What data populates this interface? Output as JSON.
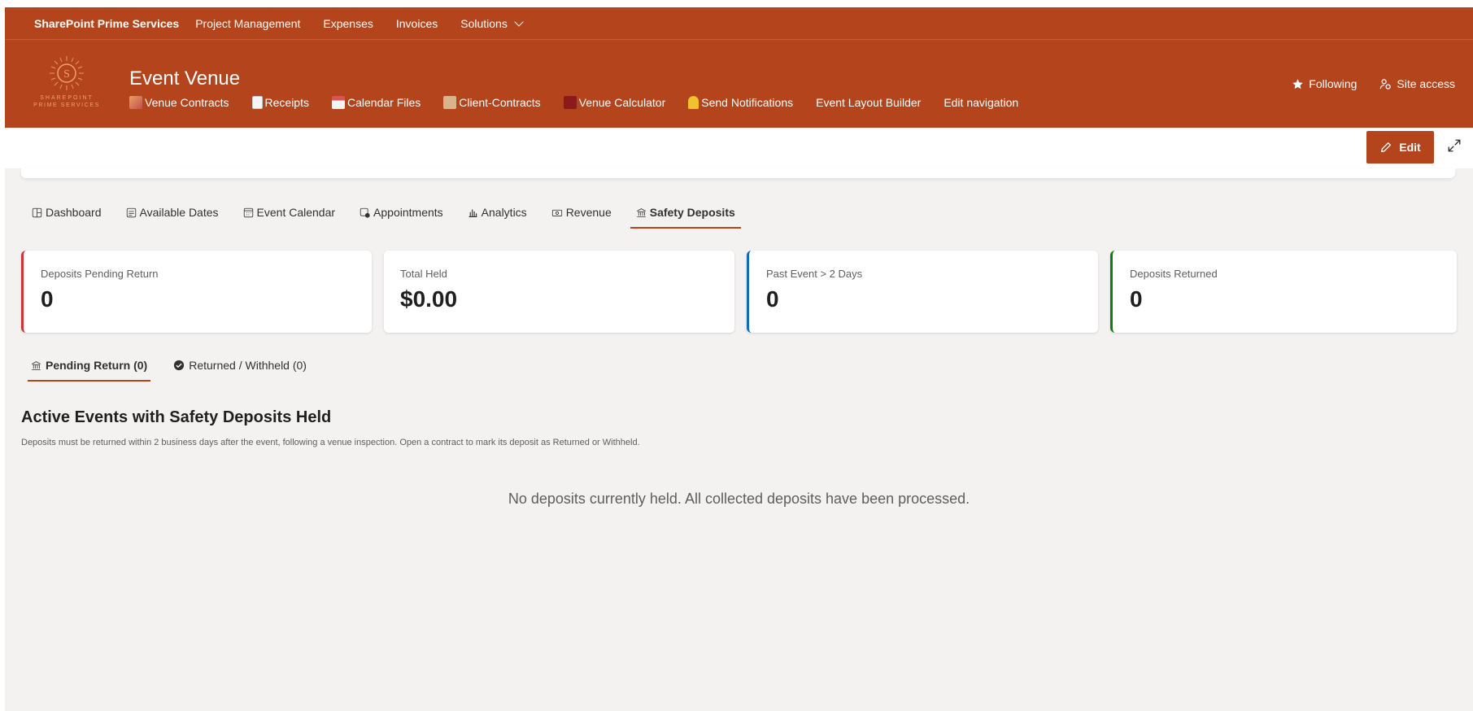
{
  "suite_bar": {
    "brand": "SharePoint Prime Services",
    "nav": [
      "Project Management",
      "Expenses",
      "Invoices",
      "Solutions"
    ]
  },
  "header": {
    "logo_text_line1": "SHAREPOINT",
    "logo_text_line2": "PRIME SERVICES",
    "logo_letter": "S",
    "site_title": "Event Venue",
    "nav": [
      {
        "label": "Venue Contracts",
        "icon": "people-emoji-icon"
      },
      {
        "label": "Receipts",
        "icon": "receipt-emoji-icon"
      },
      {
        "label": "Calendar Files",
        "icon": "calendar-emoji-icon"
      },
      {
        "label": "Client-Contracts",
        "icon": "scroll-emoji-icon"
      },
      {
        "label": "Venue Calculator",
        "icon": "calculator-emoji-icon"
      },
      {
        "label": "Send Notifications",
        "icon": "bell-emoji-icon"
      },
      {
        "label": "Event Layout Builder",
        "icon": ""
      },
      {
        "label": "Edit navigation",
        "icon": ""
      }
    ],
    "following_label": "Following",
    "site_access_label": "Site access"
  },
  "command_bar": {
    "edit_label": "Edit"
  },
  "tabs": [
    {
      "label": "Dashboard",
      "icon": "dashboard-icon",
      "active": false
    },
    {
      "label": "Available Dates",
      "icon": "calendar-list-icon",
      "active": false
    },
    {
      "label": "Event Calendar",
      "icon": "calendar-icon",
      "active": false
    },
    {
      "label": "Appointments",
      "icon": "appointment-icon",
      "active": false
    },
    {
      "label": "Analytics",
      "icon": "bar-chart-icon",
      "active": false
    },
    {
      "label": "Revenue",
      "icon": "money-icon",
      "active": false
    },
    {
      "label": "Safety Deposits",
      "icon": "bank-icon",
      "active": true
    }
  ],
  "cards": [
    {
      "label": "Deposits Pending Return",
      "value": "0",
      "accent": "#d13438"
    },
    {
      "label": "Total Held",
      "value": "$0.00",
      "accent": ""
    },
    {
      "label": "Past Event > 2 Days",
      "value": "0",
      "accent": "#0f6cbd"
    },
    {
      "label": "Deposits Returned",
      "value": "0",
      "accent": "#107c10"
    }
  ],
  "subtabs": [
    {
      "label": "Pending Return (0)",
      "icon": "bank-icon",
      "active": true
    },
    {
      "label": "Returned / Withheld (0)",
      "icon": "check-circle-icon",
      "active": false
    }
  ],
  "section": {
    "title": "Active Events with Safety Deposits Held",
    "description": "Deposits must be returned within 2 business days after the event, following a venue inspection. Open a contract to mark its deposit as Returned or Withheld.",
    "empty_message": "No deposits currently held. All collected deposits have been processed."
  },
  "colors": {
    "brand": "#b3441c",
    "background": "#f3f2f1"
  }
}
